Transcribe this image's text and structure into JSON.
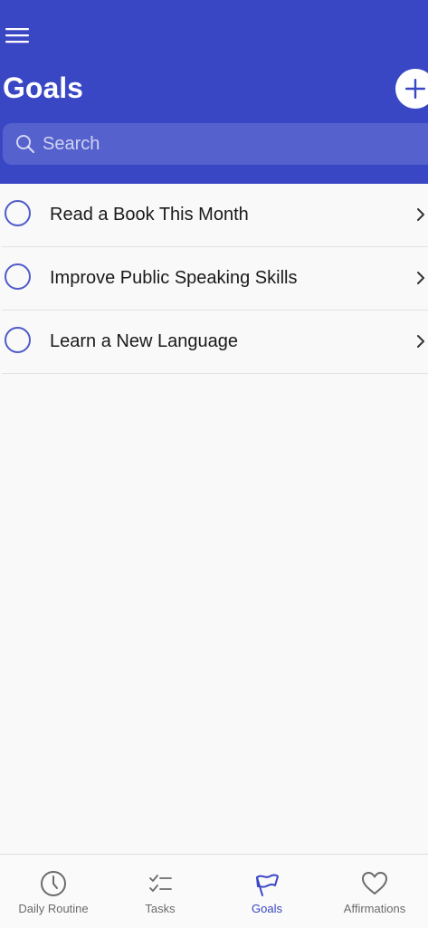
{
  "colors": {
    "header_bg": "#3a47c5",
    "accent": "#3a47c5",
    "list_bg": "#f9f9f9",
    "circle_border": "#4f5bc9",
    "inactive_tab": "#6b6b6b"
  },
  "header": {
    "menu_icon": "hamburger-icon",
    "title": "Goals",
    "add_icon": "plus-icon"
  },
  "search": {
    "icon": "search-icon",
    "placeholder": "Search",
    "value": ""
  },
  "goals": [
    {
      "label": "Read a Book This Month",
      "completed": false
    },
    {
      "label": "Improve Public Speaking Skills",
      "completed": false
    },
    {
      "label": "Learn a New Language",
      "completed": false
    }
  ],
  "tabs": [
    {
      "label": "Daily Routine",
      "icon": "clock-icon",
      "active": false
    },
    {
      "label": "Tasks",
      "icon": "checklist-icon",
      "active": false
    },
    {
      "label": "Goals",
      "icon": "flag-icon",
      "active": true
    },
    {
      "label": "Affirmations",
      "icon": "heart-icon",
      "active": false
    }
  ]
}
